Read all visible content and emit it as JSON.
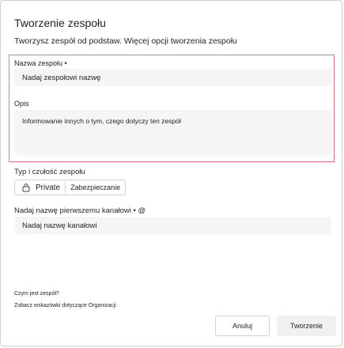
{
  "dialog": {
    "title": "Tworzenie zespołu",
    "subtitle": "Tworzysz zespół od podstaw. Więcej opcji tworzenia zespołu"
  },
  "team_name": {
    "label": "Nazwa zespołu •",
    "placeholder": "Nadaj zespołowi nazwę"
  },
  "description": {
    "label": "Opis",
    "placeholder": "Informowanie innych o tym, czego dotyczy ten zespół"
  },
  "type_sensitivity": {
    "label": "Typ i czułość zespołu",
    "type_value": "Private",
    "type_icon": "lock-icon",
    "security_value": "Zabezpieczanie"
  },
  "first_channel": {
    "label": "Nadaj nazwę pierwszemu kanałowi • @",
    "placeholder": "Nadaj nazwę kanałowi"
  },
  "links": {
    "what_is_team": "Czym jest zespół?",
    "org_guidelines": "Zobacz wskazówki dotyczące Organizacji"
  },
  "buttons": {
    "cancel": "Anuluj",
    "create": "Tworzenie"
  },
  "colors": {
    "highlight_border": "#e8737a",
    "input_background": "#f5f5f5"
  }
}
